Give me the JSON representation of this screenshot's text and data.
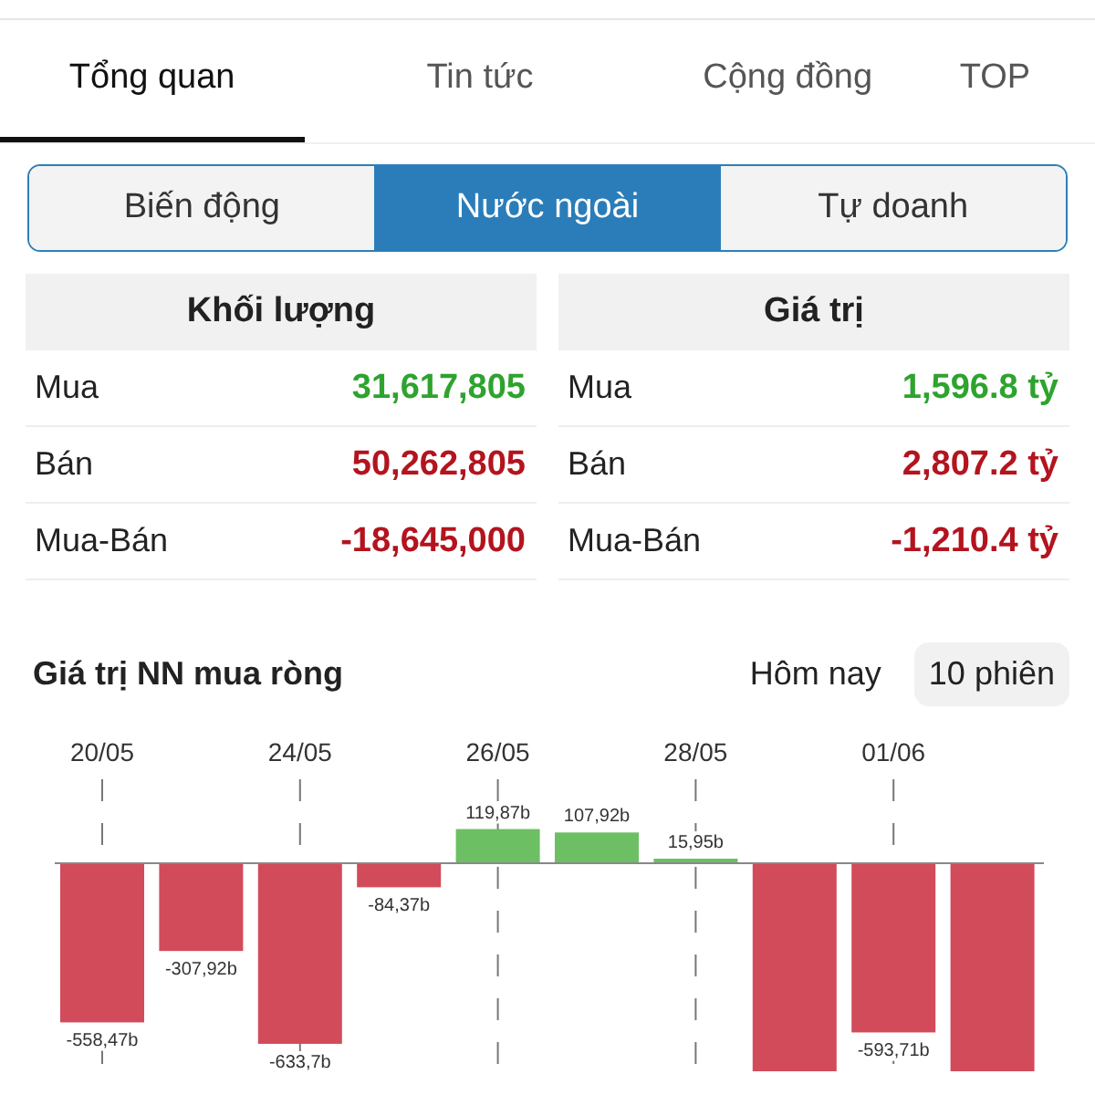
{
  "tabs": [
    {
      "label": "Tổng quan",
      "selected": true
    },
    {
      "label": "Tin tức",
      "selected": false
    },
    {
      "label": "Cộng đồng",
      "selected": false
    },
    {
      "label": "TOP",
      "selected": false
    }
  ],
  "segments": [
    {
      "label": "Biến động",
      "selected": false
    },
    {
      "label": "Nước ngoài",
      "selected": true
    },
    {
      "label": "Tự doanh",
      "selected": false
    }
  ],
  "tables": [
    {
      "title": "Khối lượng",
      "rows": [
        {
          "label": "Mua",
          "value": "31,617,805",
          "kind": "up"
        },
        {
          "label": "Bán",
          "value": "50,262,805",
          "kind": "down"
        },
        {
          "label": "Mua-Bán",
          "value": "-18,645,000",
          "kind": "down"
        }
      ]
    },
    {
      "title": "Giá trị",
      "rows": [
        {
          "label": "Mua",
          "value": "1,596.8 tỷ",
          "kind": "up"
        },
        {
          "label": "Bán",
          "value": "2,807.2 tỷ",
          "kind": "down"
        },
        {
          "label": "Mua-Bán",
          "value": "-1,210.4 tỷ",
          "kind": "down"
        }
      ]
    }
  ],
  "chart_section": {
    "title": "Giá trị NN mua ròng",
    "periods": [
      {
        "label": "Hôm nay",
        "selected": false
      },
      {
        "label": "10 phiên",
        "selected": true
      }
    ],
    "chart_data": {
      "type": "bar",
      "categories": [
        "20/05",
        null,
        "24/05",
        null,
        "26/05",
        null,
        "28/05",
        null,
        "01/06",
        null
      ],
      "series": [
        {
          "color": "#6cbf63",
          "values": [
            null,
            null,
            null,
            null,
            119.87,
            107.92,
            15.95,
            null,
            null,
            null
          ],
          "value_labels": [
            null,
            null,
            null,
            null,
            "119,87b",
            "107,92b",
            "15,95b",
            null,
            null,
            null
          ]
        },
        {
          "color": "#d24b5a",
          "values": [
            -558.47,
            -307.92,
            -633.7,
            -84.37,
            null,
            null,
            null,
            -730,
            -593.71,
            -730
          ],
          "value_labels": [
            "-558,47b",
            "-307,92b",
            "-633,7b",
            "-84,37b",
            null,
            null,
            null,
            null,
            "-593,71b",
            null
          ]
        }
      ],
      "grid": true,
      "data_labels": "value_labels"
    }
  }
}
